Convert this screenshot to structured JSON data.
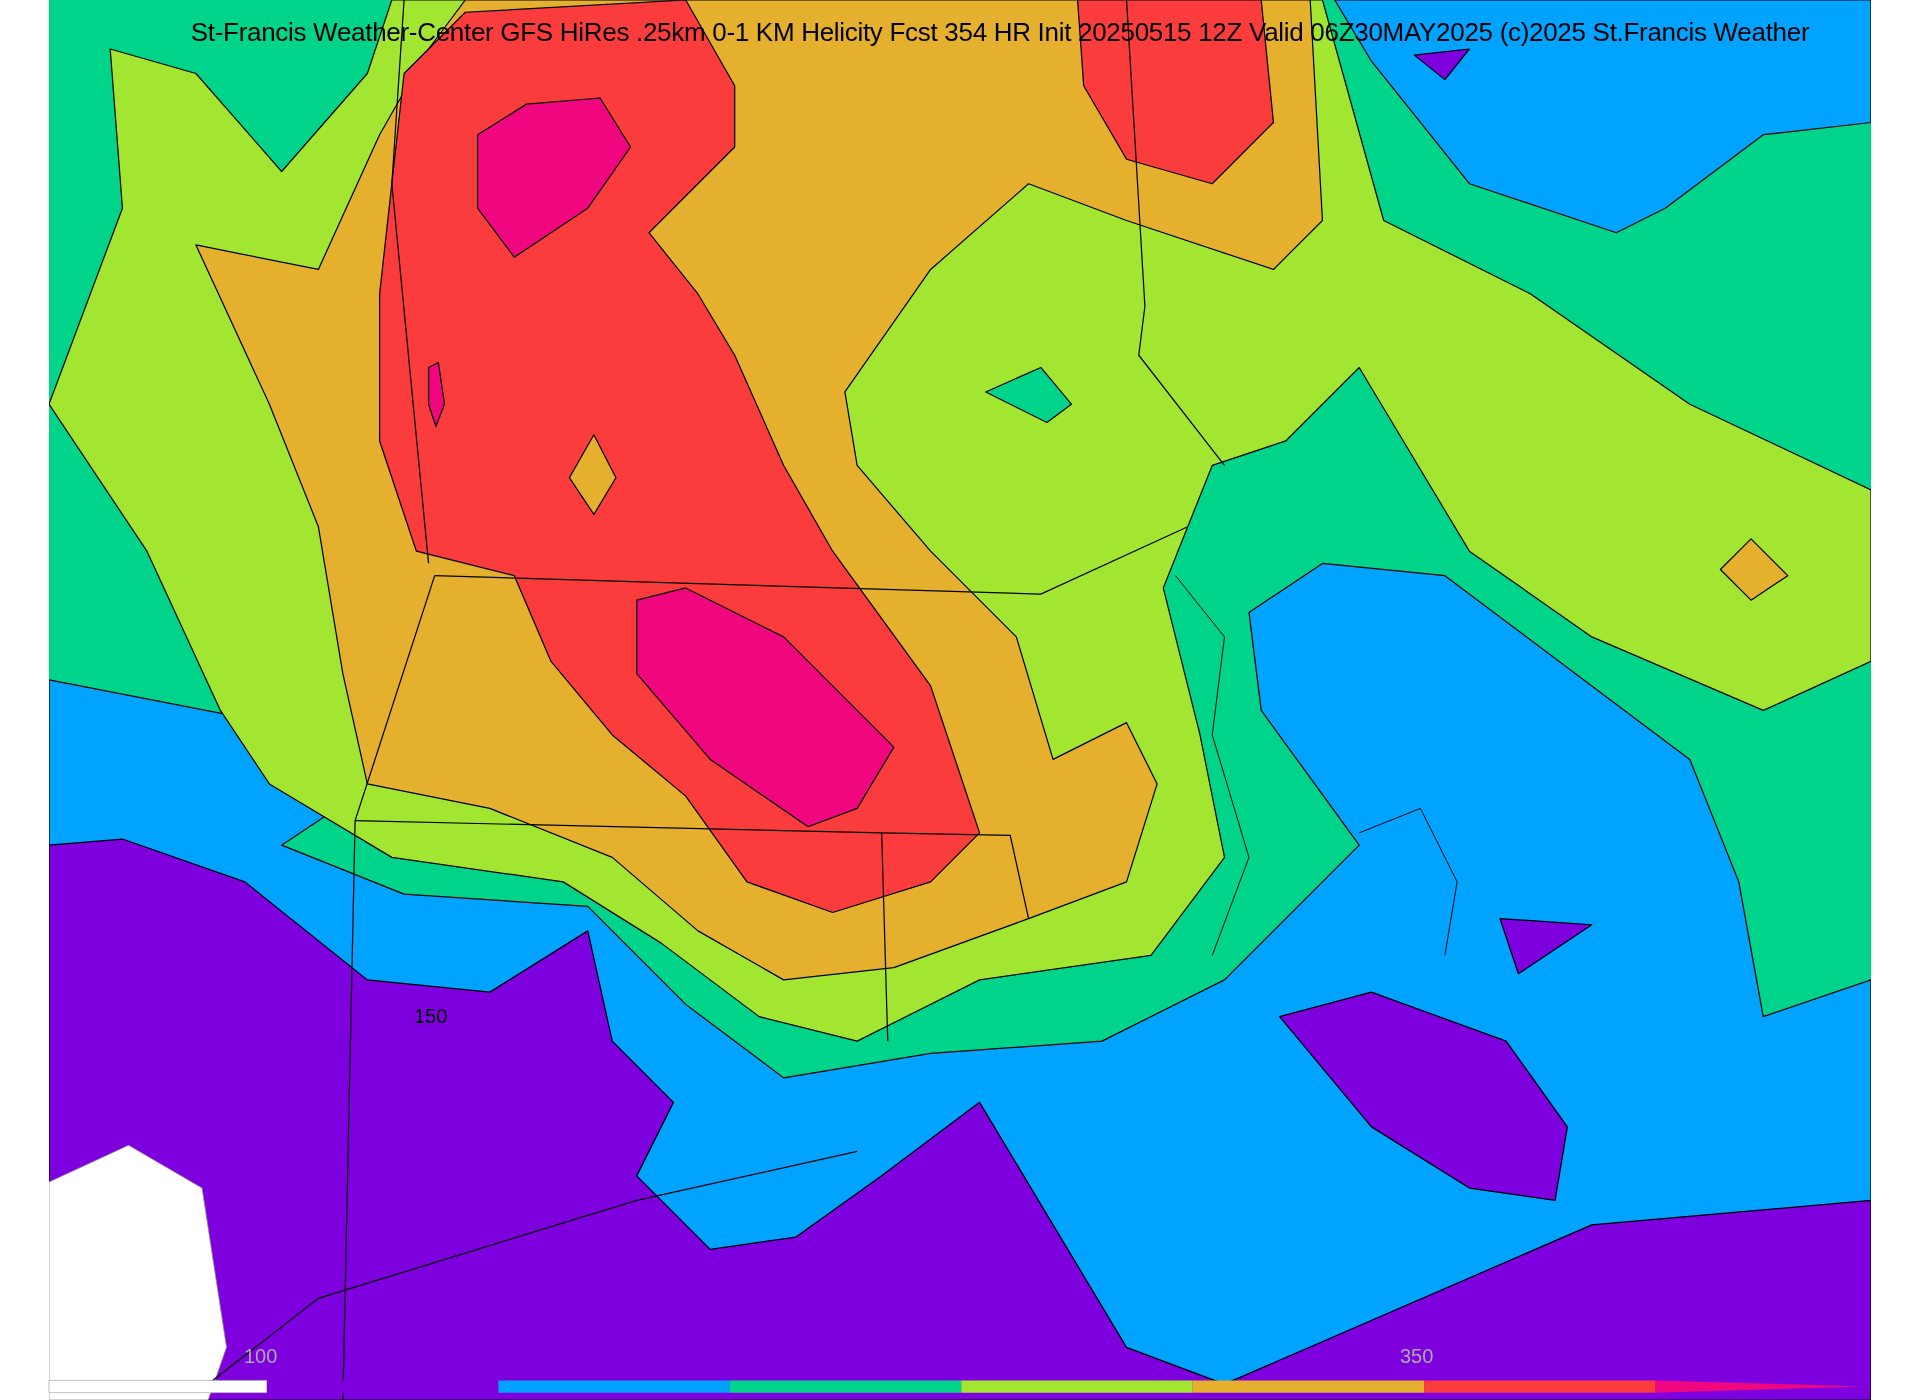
{
  "title": "St-Francis Weather-Center GFS HiRes .25km 0-1 KM Helicity Fcst 354 HR Init 20250515 12Z  Valid 06Z30MAY2025    (c)2025 St.Francis Weather",
  "contour_labels": [
    "150"
  ],
  "colorbar": {
    "labels": [
      "100",
      "350"
    ],
    "segments": [
      {
        "color": "#7f00df"
      },
      {
        "color": "#00a3ff"
      },
      {
        "color": "#00d48b"
      },
      {
        "color": "#a3e632"
      },
      {
        "color": "#e5b02e"
      },
      {
        "color": "#fa3c3c"
      },
      {
        "color": "#f0067f"
      }
    ]
  }
}
